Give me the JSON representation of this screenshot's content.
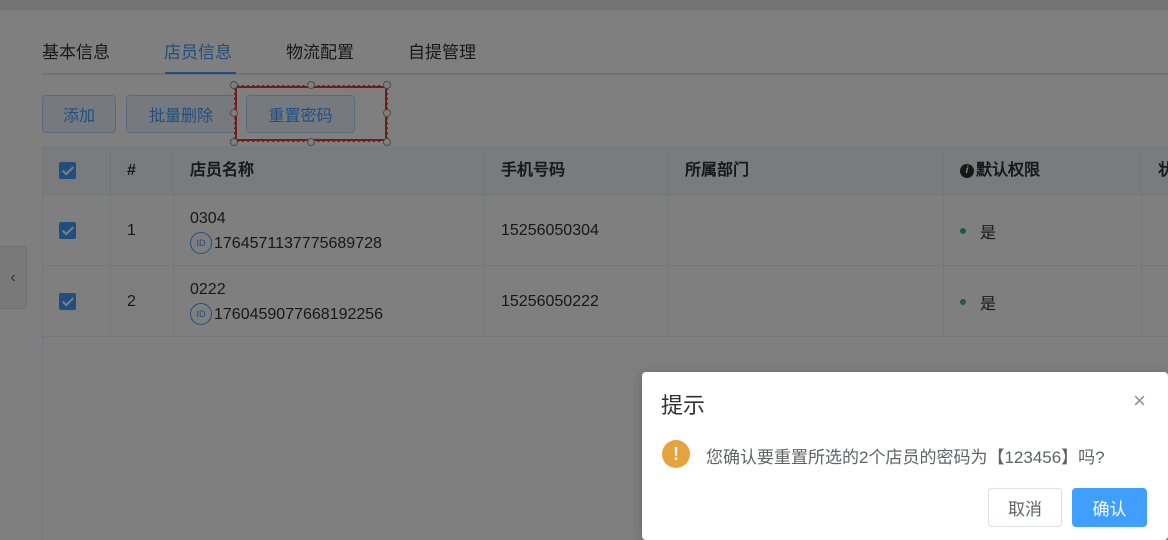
{
  "tabs": [
    {
      "label": "基本信息"
    },
    {
      "label": "店员信息"
    },
    {
      "label": "物流配置"
    },
    {
      "label": "自提管理"
    }
  ],
  "toolbar": {
    "add_label": "添加",
    "batch_delete_label": "批量删除",
    "reset_password_label": "重置密码"
  },
  "table": {
    "columns": [
      "#",
      "店员名称",
      "手机号码",
      "所属部门",
      "默认权限",
      "状"
    ],
    "rows": [
      {
        "index": "1",
        "name": "0304",
        "id_badge": "ID",
        "id": "1764571137775689728",
        "phone": "15256050304",
        "department": "",
        "default_permission": "是"
      },
      {
        "index": "2",
        "name": "0222",
        "id_badge": "ID",
        "id": "1760459077668192256",
        "phone": "15256050222",
        "department": "",
        "default_permission": "是"
      }
    ]
  },
  "dialog": {
    "title": "提示",
    "message": "您确认要重置所选的2个店员的密码为【123456】吗?",
    "cancel_label": "取消",
    "confirm_label": "确认",
    "close_icon": "×",
    "warning_icon": "!"
  },
  "colors": {
    "primary": "#409eff",
    "warning": "#e6a23c",
    "status_dot": "#3fb29b",
    "highlight": "#e53935"
  }
}
